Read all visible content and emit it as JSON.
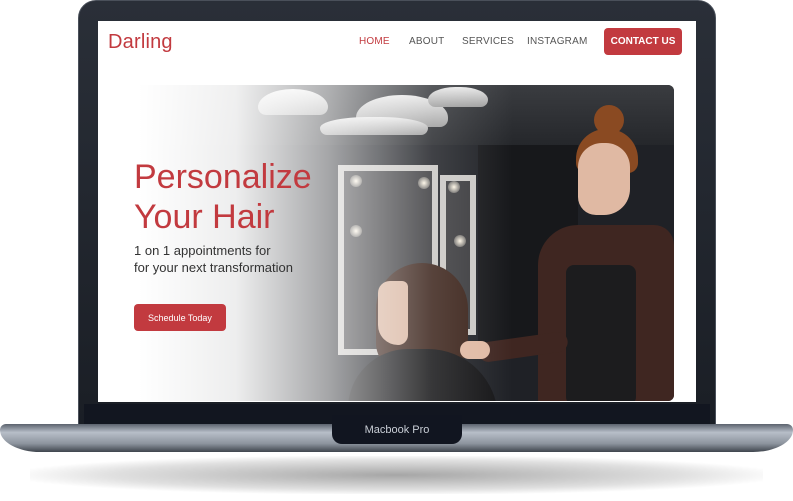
{
  "device_label": "Macbook Pro",
  "site": {
    "brand": "Darling",
    "nav": [
      {
        "label": "HOME",
        "active": true
      },
      {
        "label": "ABOUT",
        "active": false
      },
      {
        "label": "SERVICES",
        "active": false
      },
      {
        "label": "INSTAGRAM",
        "active": false
      }
    ],
    "cta_label": "CONTACT US",
    "hero": {
      "headline_line1": "Personalize",
      "headline_line2": "Your Hair",
      "sub_line1": "1 on 1 appointments for",
      "sub_line2": "for your next transformation",
      "button_label": "Schedule Today"
    }
  },
  "colors": {
    "accent": "#c23a3f",
    "laptop_frame": "#1a1e25"
  }
}
